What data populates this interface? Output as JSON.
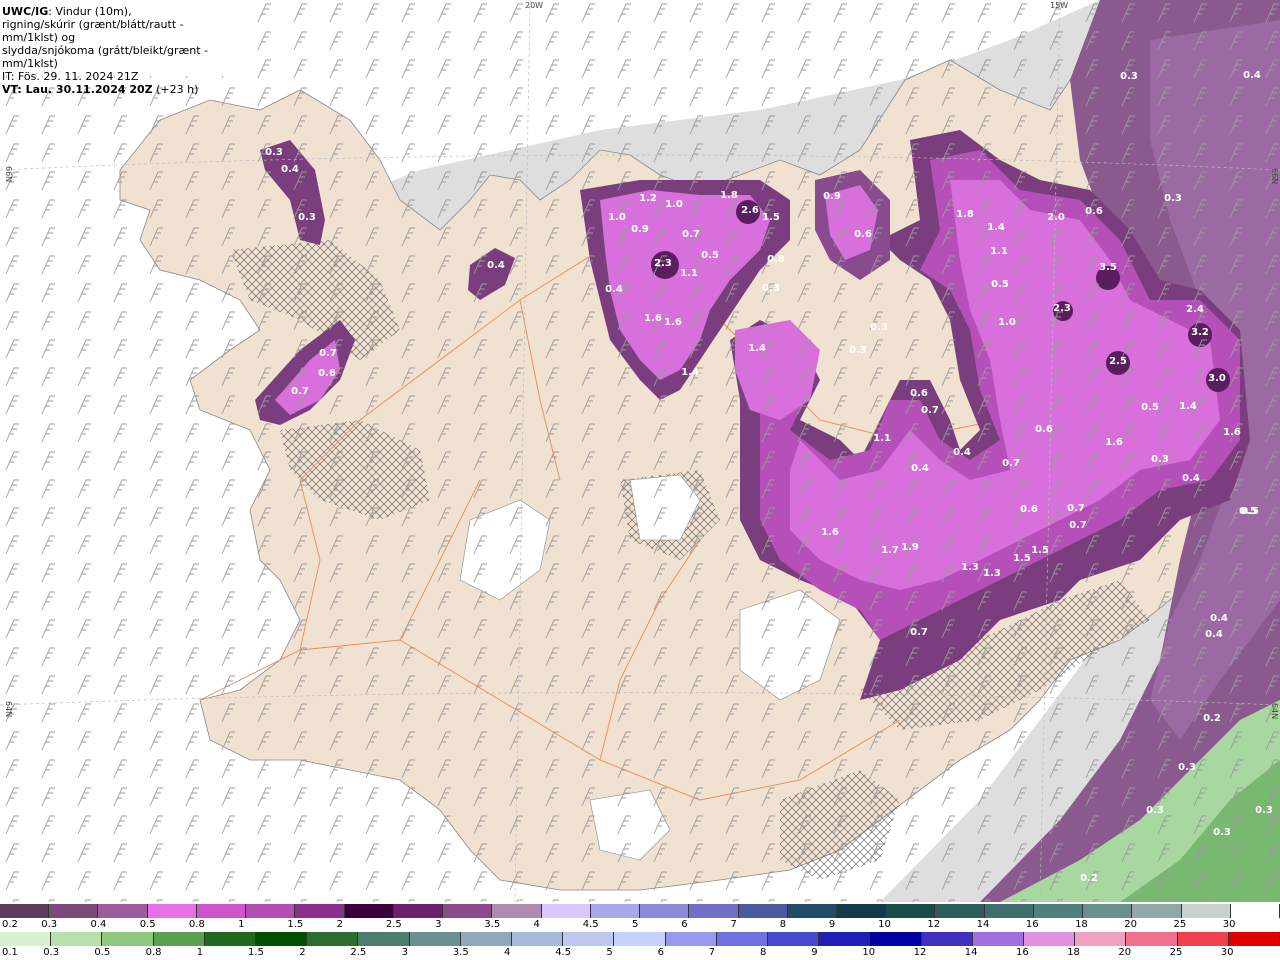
{
  "header": {
    "line1_bold": "UWC/IG",
    "line1_rest": ": Vindur (10m),",
    "line2": "rigning/skúrir (grænt/blátt/rautt - mm/1klst) og",
    "line3": "slydda/snjókoma (grátt/bleikt/grænt - mm/1klst)",
    "line4": "IT: Fös. 29. 11. 2024 21Z",
    "line5_bold": "VT: Lau. 30.11.2024 20Z",
    "line5_rest": " (+23 h)"
  },
  "grid_labels": [
    "20W",
    "15W",
    "66N",
    "66N",
    "64N",
    "64N"
  ],
  "precip_labels": [
    "0.3",
    "0.4",
    "0.3",
    "0.4",
    "0.7",
    "0.6",
    "0.7",
    "1.0",
    "1.2",
    "1.0",
    "0.9",
    "1.8",
    "2.6",
    "1.5",
    "0.9",
    "0.7",
    "0.6",
    "1.8",
    "2.0",
    "0.6",
    "1.4",
    "1.1",
    "2.3",
    "1.1",
    "0.5",
    "0.8",
    "0.4",
    "1.6",
    "1.6",
    "0.3",
    "0.5",
    "1.0",
    "2.3",
    "3.5",
    "1.4",
    "1.4",
    "0.3",
    "0.3",
    "2.5",
    "2.4",
    "3.2",
    "3.0",
    "1.4",
    "1.6",
    "0.6",
    "0.7",
    "0.6",
    "1.1",
    "0.4",
    "0.4",
    "0.7",
    "1.6",
    "0.5",
    "0.3",
    "0.4",
    "0.5",
    "0.6",
    "0.7",
    "0.7",
    "1.6",
    "1.7",
    "1.9",
    "1.3",
    "1.3",
    "1.5",
    "1.5",
    "0.7",
    "0.4",
    "0.4",
    "0.5",
    "0.2",
    "0.3",
    "0.3",
    "0.3",
    "0.2",
    "0.3",
    "0.3",
    "0.4",
    "0.3"
  ],
  "scale_snow": {
    "labels": [
      "0.2",
      "0.3",
      "0.4",
      "0.5",
      "0.8",
      "1",
      "1.5",
      "2",
      "2.5",
      "3",
      "3.5",
      "4",
      "4.5",
      "5",
      "6",
      "7",
      "8",
      "9",
      "10",
      "12",
      "14",
      "16",
      "18",
      "20",
      "25",
      "30"
    ],
    "colors": [
      "#5e3b5e",
      "#7a4b7a",
      "#9d5b9d",
      "#e670e6",
      "#cc55cc",
      "#b34db3",
      "#8c2e8c",
      "#3c003c",
      "#6a206a",
      "#8c4a8c",
      "#b08ab0",
      "#d8c8ff",
      "#a8a8e8",
      "#8a8ad8",
      "#7070c8",
      "#4a5a9a",
      "#244a6a",
      "#143a4a",
      "#1a4a4a",
      "#2c5c5c",
      "#3e6e6e",
      "#507f7f",
      "#6a9090",
      "#90a8a8",
      "#c8d0d0",
      "#ffffff"
    ]
  },
  "scale_rain": {
    "labels": [
      "0.1",
      "0.3",
      "0.5",
      "0.8",
      "1",
      "1.5",
      "2",
      "2.5",
      "3",
      "3.5",
      "4",
      "4.5",
      "5",
      "6",
      "7",
      "8",
      "9",
      "10",
      "12",
      "14",
      "16",
      "18",
      "20",
      "25",
      "30"
    ],
    "colors": [
      "#d8f0d0",
      "#b8e0a8",
      "#90c880",
      "#5aa050",
      "#206820",
      "#005000",
      "#2c6c2c",
      "#4c7c6c",
      "#6a9090",
      "#90a8b8",
      "#a8b8d8",
      "#c0c8f0",
      "#c8d0ff",
      "#9898f0",
      "#7070e0",
      "#4848d0",
      "#2020b8",
      "#0000a0",
      "#4030c0",
      "#a070e0",
      "#e090e0",
      "#f0a0c0",
      "#f07090",
      "#f04050",
      "#e00000"
    ]
  }
}
